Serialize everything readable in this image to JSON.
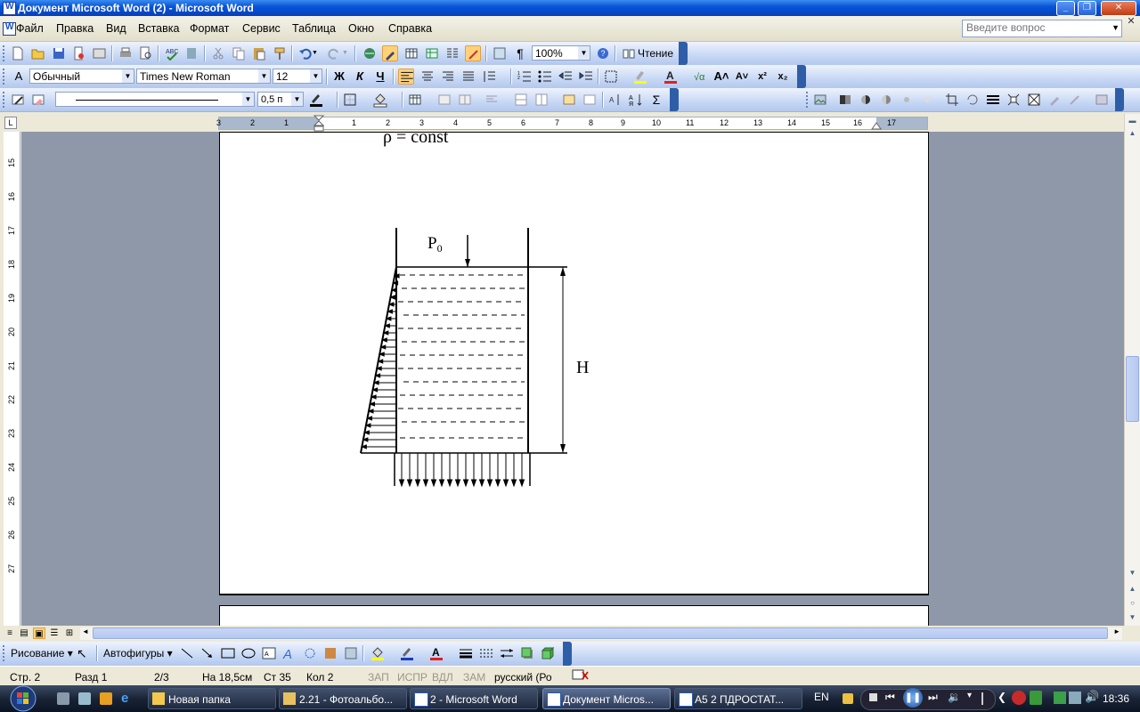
{
  "window": {
    "title": "Документ Microsoft Word (2) - Microsoft Word"
  },
  "menu": {
    "items": [
      "Файл",
      "Правка",
      "Вид",
      "Вставка",
      "Формат",
      "Сервис",
      "Таблица",
      "Окно",
      "Справка"
    ],
    "ask_placeholder": "Введите вопрос"
  },
  "toolbar_standard": {
    "zoom": "100%",
    "reading_label": "Чтение"
  },
  "toolbar_format": {
    "style": "Обычный",
    "font": "Times New Roman",
    "size": "12"
  },
  "toolbar_tables": {
    "line_weight": "0,5 п"
  },
  "ruler": {
    "h_left": [
      "3",
      "2",
      "1"
    ],
    "h_right": [
      "1",
      "2",
      "3",
      "4",
      "5",
      "6",
      "7",
      "8",
      "9",
      "10",
      "11",
      "12",
      "13",
      "14",
      "15",
      "16",
      "17"
    ],
    "v": [
      "15",
      "16",
      "17",
      "18",
      "19",
      "20",
      "21",
      "22",
      "23",
      "24",
      "25",
      "26",
      "27"
    ]
  },
  "document": {
    "line1": "ρ = const",
    "figure": {
      "p0_label": "P",
      "p0_sub": "0",
      "h_label": "H"
    }
  },
  "drawing_toolbar": {
    "drawing": "Рисование",
    "autoshapes": "Автофигуры"
  },
  "status": {
    "page": "Стр. 2",
    "section": "Разд 1",
    "pages": "2/3",
    "at": "На 18,5см",
    "line": "Ст 35",
    "col": "Кол 2",
    "rec": "ЗАП",
    "trk": "ИСПР",
    "ext": "ВДЛ",
    "ovr": "ЗАМ",
    "lang": "русский (Ро"
  },
  "taskbar": {
    "tasks": [
      "Новая папка",
      "2.21 - Фотоальбо...",
      "2 - Microsoft Word",
      "Документ Micros...",
      "А5 2 ПДРОСТАТ..."
    ],
    "lang": "EN",
    "time": "18:36"
  }
}
